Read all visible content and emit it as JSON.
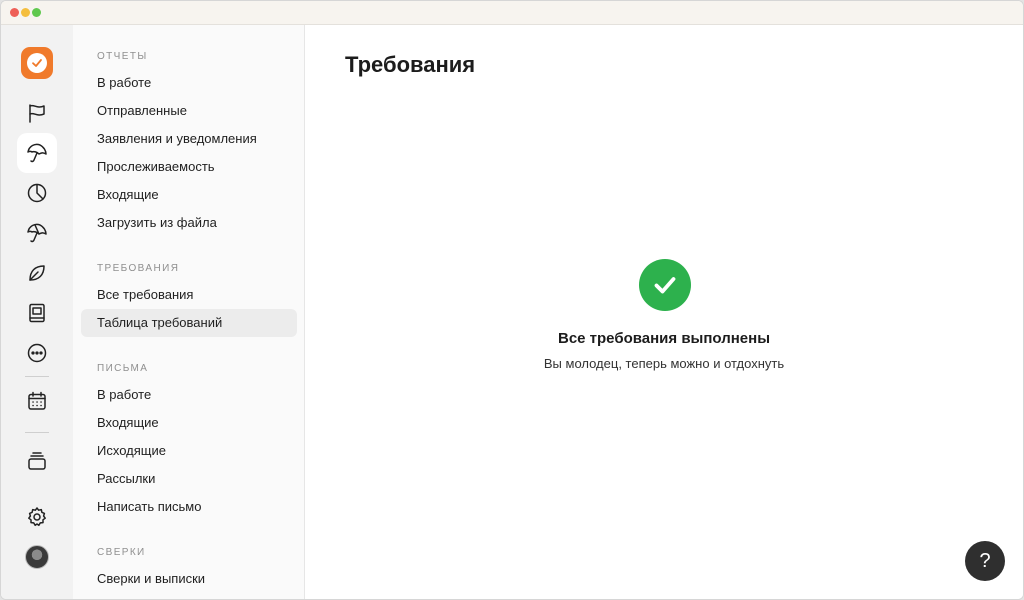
{
  "window": {
    "controls": [
      "close",
      "minimize",
      "zoom"
    ]
  },
  "rail": {
    "logo_icon": "checkmark-badge-icon",
    "brand_color": "#f07a2b",
    "items": [
      {
        "icon": "flag-icon"
      },
      {
        "icon": "umbrella-icon",
        "active": true
      },
      {
        "icon": "pie-chart-icon"
      },
      {
        "icon": "umbrella-outline-icon"
      },
      {
        "icon": "leaf-icon"
      },
      {
        "icon": "book-icon"
      },
      {
        "icon": "more-icon"
      },
      {
        "icon": "calendar-icon"
      },
      {
        "icon": "layers-icon"
      },
      {
        "icon": "gear-icon"
      }
    ]
  },
  "nav": {
    "sections": [
      {
        "title": "ОТЧЕТЫ",
        "items": [
          "В работе",
          "Отправленные",
          "Заявления и уведомления",
          "Прослеживаемость",
          "Входящие",
          "Загрузить из файла"
        ]
      },
      {
        "title": "ТРЕБОВАНИЯ",
        "items": [
          "Все требования",
          "Таблица требований"
        ],
        "active_index": 1
      },
      {
        "title": "ПИСЬМА",
        "items": [
          "В работе",
          "Входящие",
          "Исходящие",
          "Рассылки",
          "Написать письмо"
        ]
      },
      {
        "title": "СВЕРКИ",
        "items": [
          "Сверки и выписки"
        ]
      }
    ]
  },
  "main": {
    "title": "Требования",
    "empty_state": {
      "icon": "check-circle-icon",
      "color": "#2db14d",
      "title": "Все требования выполнены",
      "subtitle": "Вы молодец, теперь можно и отдохнуть"
    },
    "help_label": "?"
  }
}
